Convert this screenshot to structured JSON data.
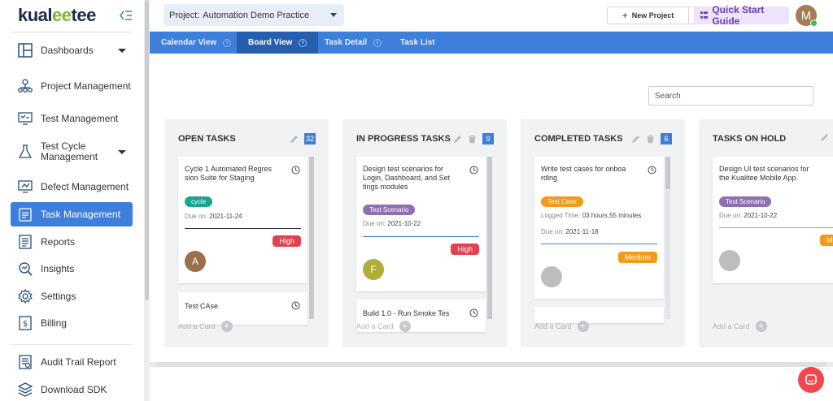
{
  "sidebar": {
    "logo": {
      "pre": "kual",
      "mid": "ee",
      "post": "tee"
    },
    "items": [
      {
        "label": "Dashboards",
        "icon": "dashboard-icon",
        "caret": true
      },
      {
        "label": "Project Management",
        "icon": "project-icon"
      },
      {
        "label": "Test Management",
        "icon": "test-management-icon"
      },
      {
        "label": "Test Cycle Management",
        "icon": "test-cycle-icon",
        "caret": true
      },
      {
        "label": "Defect Management",
        "icon": "defect-icon"
      },
      {
        "label": "Task Management",
        "icon": "task-icon",
        "active": true
      },
      {
        "label": "Reports",
        "icon": "reports-icon"
      },
      {
        "label": "Insights",
        "icon": "insights-icon"
      },
      {
        "label": "Settings",
        "icon": "settings-icon"
      },
      {
        "label": "Billing",
        "icon": "billing-icon"
      },
      {
        "label": "Audit Trail Report",
        "icon": "audit-icon"
      },
      {
        "label": "Download SDK",
        "icon": "sdk-icon"
      }
    ]
  },
  "topbar": {
    "project_label": "Project:",
    "project_value": "Automation Demo Practice",
    "new_project": "New Project",
    "quick_start": "Quick Start Guide",
    "avatar_initial": "M"
  },
  "tabs": [
    {
      "label": "Calendar View",
      "info": true
    },
    {
      "label": "Board View",
      "info": true,
      "active": true
    },
    {
      "label": "Task Detail",
      "info": true
    },
    {
      "label": "Task List",
      "info": false
    }
  ],
  "search": {
    "placeholder": "Search"
  },
  "colors": {
    "accent": "#3d7fdb",
    "high": "#e0424f",
    "medium": "#f29a1a",
    "cycle": "#1aa58e",
    "scenario": "#8e6fb0",
    "testcase": "#f29a1a"
  },
  "columns": [
    {
      "title": "OPEN TASKS",
      "count": "32",
      "card": {
        "title": "Cycle 1 Automated Regres sion Suite for Staging",
        "tag": "cycle",
        "due_label": "Due on:",
        "due": "2021-11-24",
        "priority": "High",
        "avatar": "A"
      },
      "next_card": "Test CAse",
      "add": "Add a Card"
    },
    {
      "title": "IN PROGRESS TASKS",
      "count": "9",
      "card": {
        "title": "Design test scenarios for Login, Dashboard, and Set tings modules",
        "tag": "Test Scenario",
        "due_label": "Due on:",
        "due": "2021-10-22",
        "priority": "High",
        "avatar": "F"
      },
      "next_card": "Build 1.0 - Run Smoke Tes",
      "add": "Add a Card"
    },
    {
      "title": "COMPLETED TASKS",
      "count": "6",
      "card": {
        "title": "Write test cases for onboa rding",
        "tag": "Test Case",
        "logged_label": "Logged Time:",
        "logged": "03 hours,55 minutes",
        "due_label": "Due on:",
        "due": "2021-11-18",
        "priority": "Medium"
      },
      "add": "Add a Card"
    },
    {
      "title": "TASKS ON HOLD",
      "card": {
        "title": "Design UI test scenarios for the Kualitee Mobile App.",
        "tag": "Test Scenario",
        "due_label": "Due on:",
        "due": "2021-10-22",
        "priority": "Medium"
      },
      "add": "Add a Card"
    }
  ]
}
